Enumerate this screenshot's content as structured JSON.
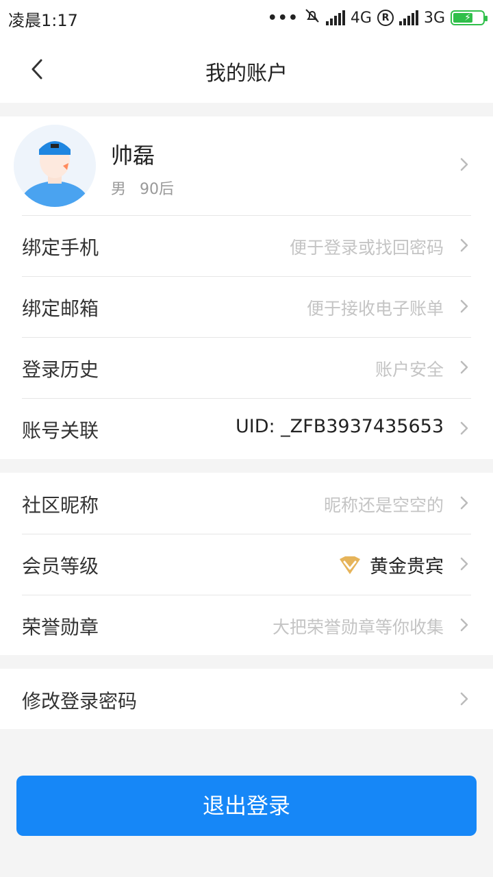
{
  "status_bar": {
    "time": "凌晨1:17",
    "dots": "•••",
    "network1": "4G",
    "roaming": "R",
    "network2": "3G"
  },
  "nav": {
    "title": "我的账户"
  },
  "profile": {
    "name": "帅磊",
    "gender": "男",
    "age_group": "90后"
  },
  "rows_section1": [
    {
      "label": "绑定手机",
      "value": "便于登录或找回密码"
    },
    {
      "label": "绑定邮箱",
      "value": "便于接收电子账单"
    },
    {
      "label": "登录历史",
      "value": "账户安全"
    },
    {
      "label": "账号关联",
      "value": "UID: _ZFB3937435653"
    }
  ],
  "rows_section2": [
    {
      "label": "社区昵称",
      "value": "昵称还是空空的"
    },
    {
      "label": "会员等级",
      "value": "黄金贵宾"
    },
    {
      "label": "荣誉勋章",
      "value": "大把荣誉勋章等你收集"
    }
  ],
  "rows_section3": [
    {
      "label": "修改登录密码"
    }
  ],
  "logout": {
    "label": "退出登录"
  },
  "colors": {
    "primary": "#1687f7",
    "gold": "#d9a441",
    "battery": "#2fbf4a"
  }
}
